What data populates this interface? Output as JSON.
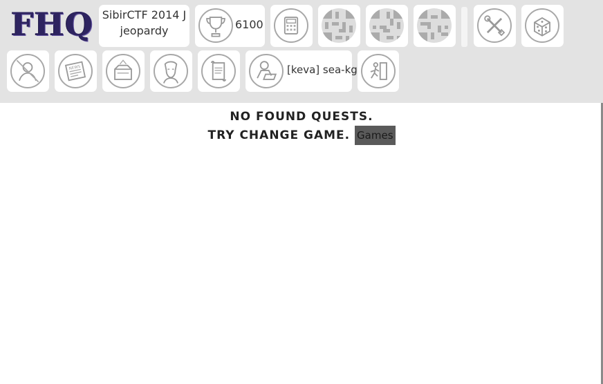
{
  "logo": {
    "text": "FHQ"
  },
  "game": {
    "line1": "SibirCTF 2014 J",
    "line2": "jeopardy"
  },
  "score": {
    "value": "6100",
    "icon": "trophy-icon"
  },
  "toolbar_row1": {
    "calculator_icon": "calculator-icon",
    "qr_icons": [
      "qr-code-icon",
      "qr-code-icon",
      "qr-code-icon"
    ],
    "settings_icon": "tools-icon",
    "random_icon": "dice-icon"
  },
  "toolbar_row2": {
    "items": [
      {
        "name": "user-icon"
      },
      {
        "name": "news-icon"
      },
      {
        "name": "feedback-icon"
      },
      {
        "name": "face-icon"
      },
      {
        "name": "rules-icon"
      }
    ],
    "user": {
      "label": "[keva] sea-kg",
      "icon": "user-computer-icon"
    },
    "exit_icon": "exit-icon"
  },
  "message": {
    "line1": "NO FOUND QUESTS.",
    "line2": "TRY CHANGE GAME.",
    "link": "Games"
  },
  "colors": {
    "topbar": "#e3e3e3",
    "link_bg": "#5a5a5a",
    "logo": "#2e2460"
  }
}
